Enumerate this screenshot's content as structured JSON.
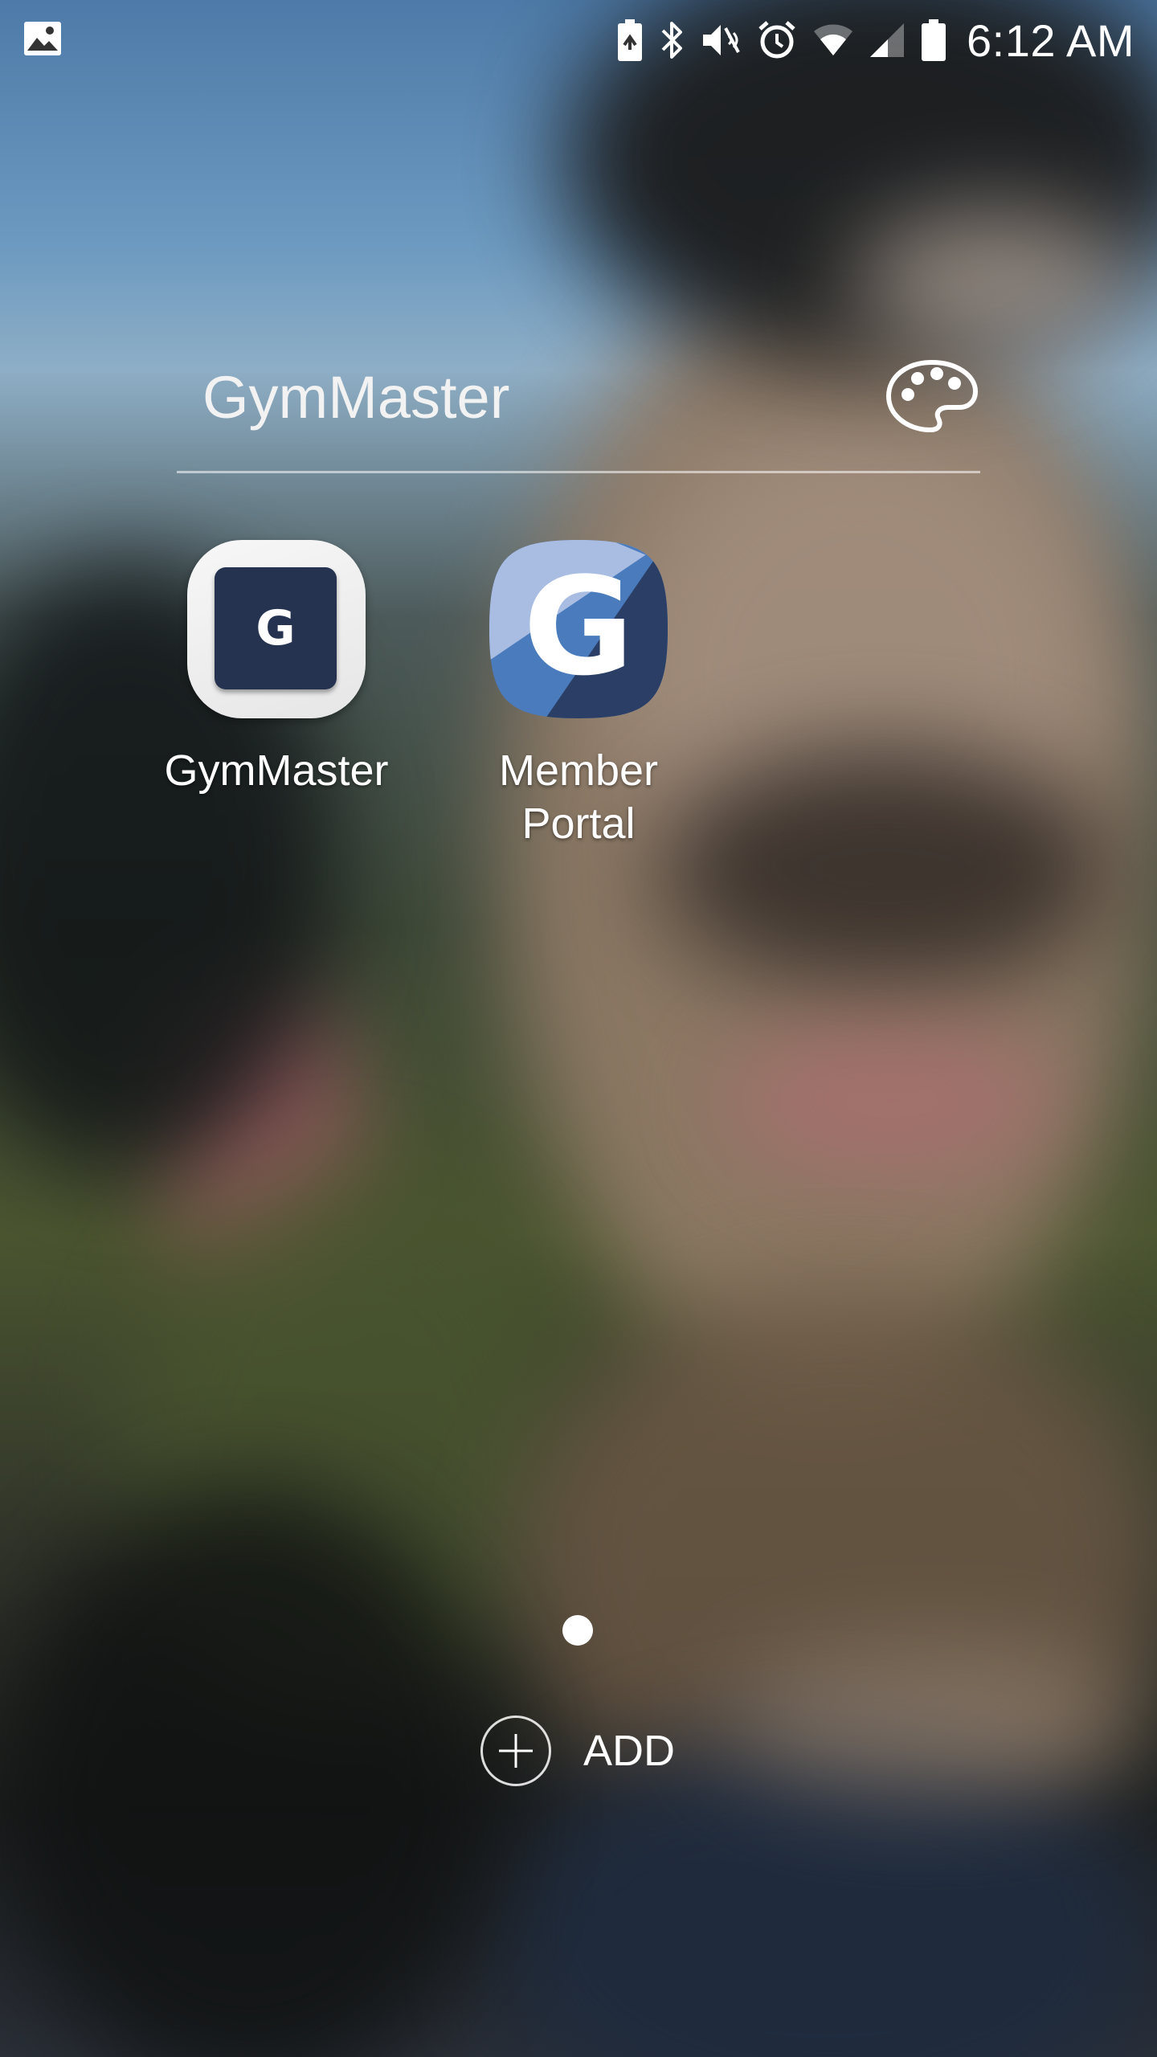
{
  "status_bar": {
    "time": "6:12 AM",
    "left_icons": [
      "gallery-notification-icon"
    ],
    "right_icons": [
      "battery-saver-icon",
      "bluetooth-icon",
      "vibrate-icon",
      "alarm-icon",
      "wifi-icon",
      "cellular-signal-icon",
      "battery-icon"
    ]
  },
  "folder": {
    "title": "GymMaster",
    "palette_icon": "palette-icon",
    "apps": [
      {
        "label": "GymMaster",
        "icon": "gymmaster-app-icon",
        "icon_letter": "G",
        "icon_color": "#253350"
      },
      {
        "label": "Member\nPortal",
        "icon": "member-portal-app-icon",
        "icon_letter": "G"
      }
    ]
  },
  "page_indicator": {
    "pages": 1,
    "current": 1
  },
  "add_button": {
    "label": "ADD",
    "icon": "plus-icon"
  },
  "colors": {
    "icon_navy": "#253350",
    "portal_blue": "#4a7bbd",
    "portal_light": "#a9bde3"
  }
}
